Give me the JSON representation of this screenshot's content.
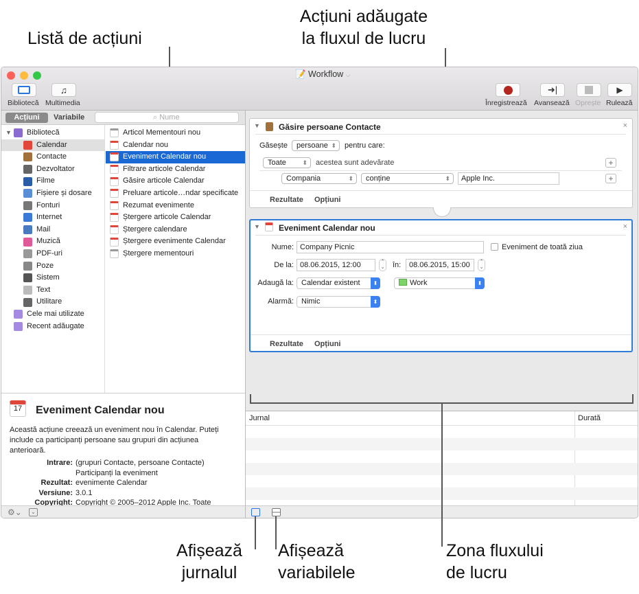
{
  "callouts": {
    "actions_list": "Listă de acțiuni",
    "added_actions_line1": "Acțiuni adăugate",
    "added_actions_line2": "la fluxul de lucru",
    "show_log_line1": "Afișează",
    "show_log_line2": "jurnalul",
    "show_vars_line1": "Afișează",
    "show_vars_line2": "variabilele",
    "workflow_area_line1": "Zona fluxului",
    "workflow_area_line2": "de lucru"
  },
  "window": {
    "title": "Workflow"
  },
  "toolbar": {
    "library": "Bibliotecă",
    "media": "Multimedia",
    "record": "Înregistrează",
    "step": "Avansează",
    "stop": "Oprește",
    "run": "Rulează"
  },
  "tabs": {
    "actions": "Acțiuni",
    "variables": "Variabile",
    "search_placeholder": "Nume"
  },
  "library": [
    {
      "label": "Bibliotecă",
      "color": "#8b6bd0"
    },
    {
      "label": "Calendar",
      "color": "#e0473a"
    },
    {
      "label": "Contacte",
      "color": "#a0713a"
    },
    {
      "label": "Dezvoltator",
      "color": "#666666"
    },
    {
      "label": "Filme",
      "color": "#2a5ca8"
    },
    {
      "label": "Fișiere și dosare",
      "color": "#5a8fd8"
    },
    {
      "label": "Fonturi",
      "color": "#777777"
    },
    {
      "label": "Internet",
      "color": "#3a7ad8"
    },
    {
      "label": "Mail",
      "color": "#4a7ac0"
    },
    {
      "label": "Muzică",
      "color": "#e05a9a"
    },
    {
      "label": "PDF-uri",
      "color": "#999999"
    },
    {
      "label": "Poze",
      "color": "#888888"
    },
    {
      "label": "Sistem",
      "color": "#555555"
    },
    {
      "label": "Text",
      "color": "#bbbbbb"
    },
    {
      "label": "Utilitare",
      "color": "#666666"
    },
    {
      "label": "Cele mai utilizate",
      "color": "#a48ae0"
    },
    {
      "label": "Recent adăugate",
      "color": "#a48ae0"
    }
  ],
  "actions": [
    "Articol Mementouri nou",
    "Calendar nou",
    "Eveniment Calendar nou",
    "Filtrare articole Calendar",
    "Găsire articole Calendar",
    "Preluare articole…ndar specificate",
    "Rezumat evenimente",
    "Ștergere articole Calendar",
    "Ștergere calendare",
    "Ștergere evenimente Calendar",
    "Ștergere mementouri"
  ],
  "description": {
    "title": "Eveniment Calendar nou",
    "text": "Această acțiune creează un eveniment nou în Calendar. Puteți include ca participanți persoane sau grupuri din acțiunea anterioară.",
    "input_label": "Intrare:",
    "input_value1": "(grupuri Contacte, persoane Contacte)",
    "input_value2": "Participanți la eveniment",
    "result_label": "Rezultat:",
    "result_value": "evenimente Calendar",
    "version_label": "Versiune:",
    "version_value": "3.0.1",
    "copyright_label": "Copyright:",
    "copyright_value": "Copyright © 2005–2012 Apple Inc. Toate"
  },
  "card1": {
    "title": "Găsire persoane Contacte",
    "find_label": "Găsește",
    "find_value": "persoane",
    "for_which": "pentru care:",
    "all_value": "Toate",
    "are_true": "acestea sunt adevărate",
    "field_value": "Compania",
    "op_value": "conține",
    "text_value": "Apple Inc.",
    "results": "Rezultate",
    "options": "Opțiuni"
  },
  "card2": {
    "title": "Eveniment Calendar nou",
    "name_label": "Nume:",
    "name_value": "Company Picnic",
    "allday_label": "Eveniment de toată ziua",
    "allday_checked": false,
    "from_label": "De la:",
    "from_value": "08.06.2015, 12:00",
    "to_label": "în:",
    "to_value": "08.06.2015, 15:00",
    "add_label": "Adaugă la:",
    "add_value": "Calendar existent",
    "calendar_value": "Work",
    "calendar_color": "#7ed36b",
    "alarm_label": "Alarmă:",
    "alarm_value": "Nimic",
    "results": "Rezultate",
    "options": "Opțiuni"
  },
  "log": {
    "col_log": "Jurnal",
    "col_duration": "Durată"
  }
}
